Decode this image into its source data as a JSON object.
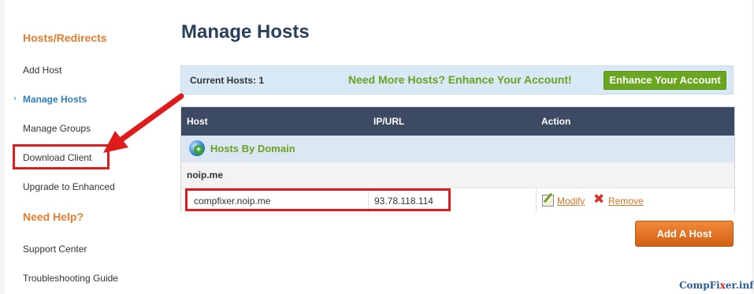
{
  "sidebar": {
    "section1_heading": "Hosts/Redirects",
    "items1": [
      {
        "label": "Add Host"
      },
      {
        "label": "Manage Hosts"
      },
      {
        "label": "Manage Groups"
      },
      {
        "label": "Download Client"
      },
      {
        "label": "Upgrade to Enhanced"
      }
    ],
    "section2_heading": "Need Help?",
    "items2": [
      {
        "label": "Support Center"
      },
      {
        "label": "Troubleshooting Guide"
      }
    ],
    "active_marker": "›"
  },
  "page": {
    "title": "Manage Hosts"
  },
  "promo": {
    "current_label": "Current Hosts:",
    "current_count": "1",
    "need_more": "Need More Hosts? Enhance Your Account!",
    "enhance_button": "Enhance Your Account"
  },
  "table": {
    "headers": [
      "Host",
      "IP/URL",
      "Action"
    ],
    "domain_label": "Hosts By Domain",
    "group": "noip.me",
    "rows": [
      {
        "host": "compfixer.noip.me",
        "ip": "93.78.118.114",
        "modify": "Modify",
        "remove": "Remove"
      }
    ]
  },
  "add_host_button": "Add A Host",
  "watermark": {
    "part1": "CompFi",
    "part2": "x",
    "part3": "er.info"
  },
  "icons": {
    "globe": "globe-add-icon",
    "edit": "edit-pencil-icon",
    "remove": "remove-x-icon"
  },
  "colors": {
    "accent_orange": "#e57c2e",
    "active_blue": "#2f7fb7",
    "header_navy": "#3d4a63",
    "green": "#6aa121",
    "annotation_red": "#e01b1b"
  }
}
